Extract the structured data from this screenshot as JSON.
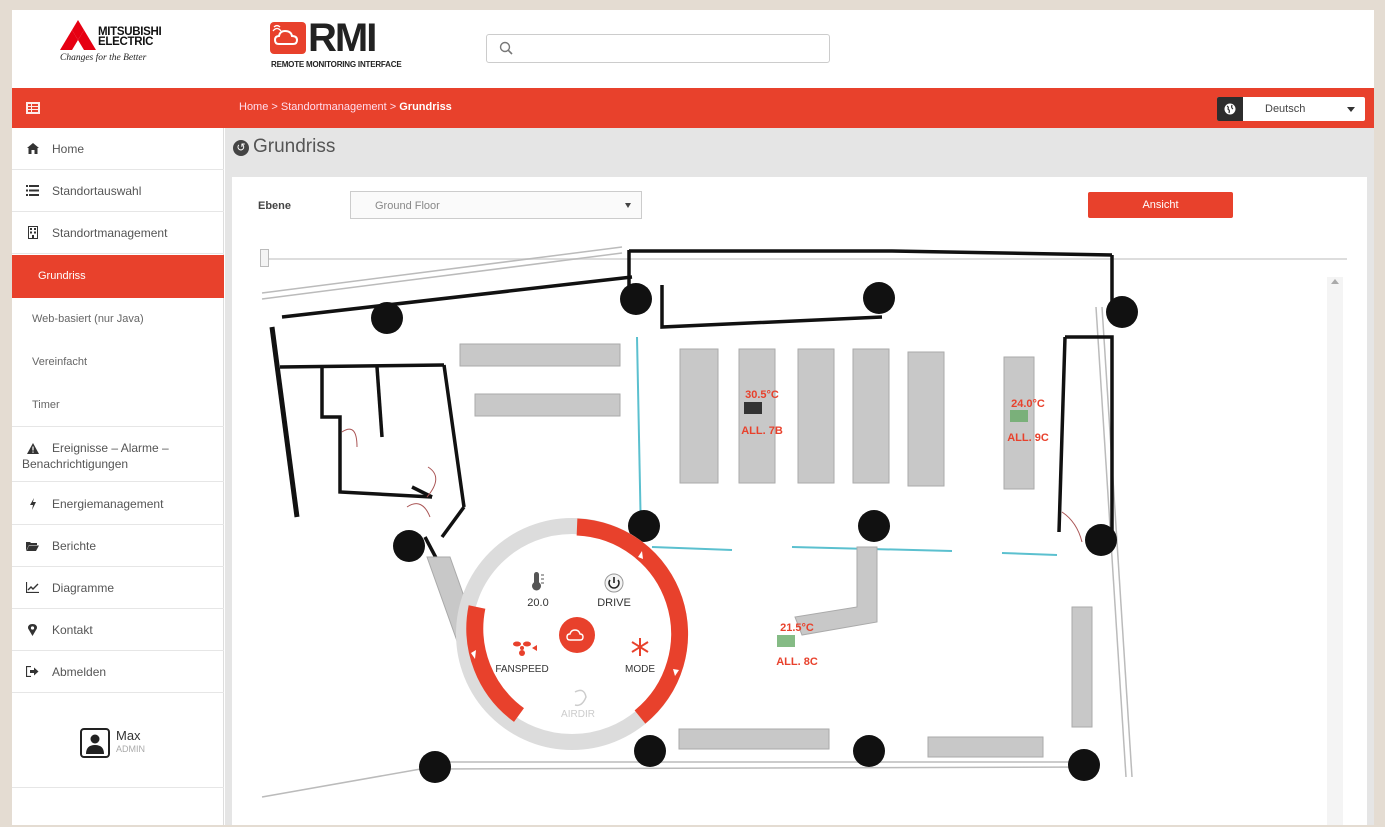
{
  "header": {
    "mitsubishi_name_line1": "MITSUBISHI",
    "mitsubishi_name_line2": "ELECTRIC",
    "mitsubishi_tagline": "Changes for the Better",
    "rmi_wordmark": "RMI",
    "rmi_subtitle": "REMOTE MONITORING INTERFACE",
    "search": {
      "value": "",
      "placeholder": ""
    }
  },
  "navbar": {
    "breadcrumb": [
      "Home",
      "Standortmanagement",
      "Grundriss"
    ],
    "language": "Deutsch"
  },
  "sidebar": {
    "items": [
      {
        "label": "Home",
        "icon": "home-icon"
      },
      {
        "label": "Standortauswahl",
        "icon": "list-icon"
      },
      {
        "label": "Standortmanagement",
        "icon": "building-icon"
      },
      {
        "label": "Grundriss",
        "active": true
      },
      {
        "label": "Web-basiert (nur Java)"
      },
      {
        "label": "Vereinfacht"
      },
      {
        "label": "Timer"
      },
      {
        "label": "Ereignisse – Alarme – Benachrichtigungen",
        "icon": "warning-icon"
      },
      {
        "label": "Energiemanagement",
        "icon": "bolt-icon"
      },
      {
        "label": "Berichte",
        "icon": "folder-icon"
      },
      {
        "label": "Diagramme",
        "icon": "chart-icon"
      },
      {
        "label": "Kontakt",
        "icon": "pin-icon"
      },
      {
        "label": "Abmelden",
        "icon": "logout-icon"
      }
    ],
    "user": {
      "name": "Max",
      "role": "ADMIN"
    }
  },
  "main": {
    "title": "Grundriss",
    "ebene_label": "Ebene",
    "ebene_value": "Ground Floor",
    "ansicht_label": "Ansicht",
    "units": [
      {
        "temp": "30.5°C",
        "name": "ALL. 7B"
      },
      {
        "temp": "24.0°C",
        "name": "ALL. 9C"
      },
      {
        "temp": "21.5°C",
        "name": "ALL. 8C"
      }
    ],
    "radial_menu": {
      "setpoint": "20.0",
      "drive": "DRIVE",
      "fanspeed": "FANSPEED",
      "mode": "MODE",
      "airdir": "AIRDIR"
    }
  },
  "colors": {
    "accent": "#e8412c",
    "dark": "#222222",
    "sidebar_text": "#555555"
  }
}
